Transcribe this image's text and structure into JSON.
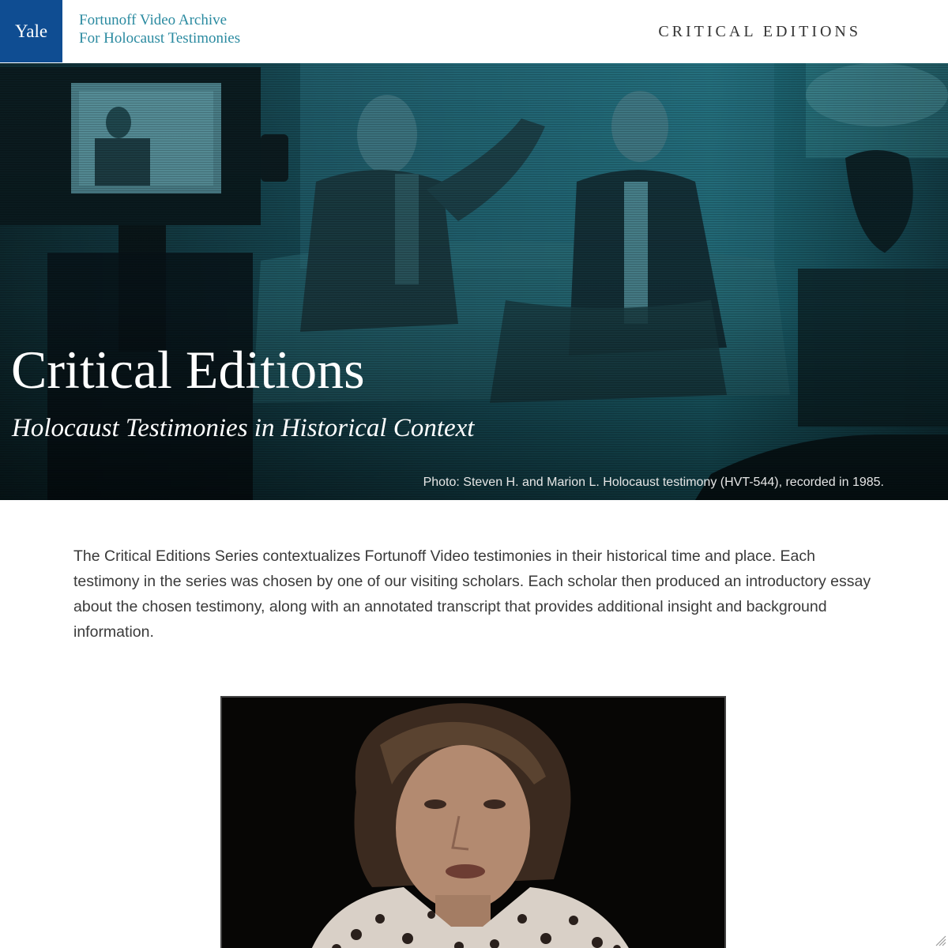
{
  "header": {
    "yale_logo": "Yale",
    "org_line1": "Fortunoff Video Archive",
    "org_line2": "For Holocaust Testimonies",
    "nav_title": "CRITICAL EDITIONS"
  },
  "hero": {
    "title": "Critical Editions",
    "subtitle": "Holocaust Testimonies in Historical Context",
    "photo_caption": "Photo: Steven H. and Marion L. Holocaust testimony (HVT-544), recorded in 1985."
  },
  "intro": {
    "text": "The Critical Editions Series contextualizes Fortunoff Video testimonies in their historical time and place. Each testimony in the series was chosen by one of our visiting scholars. Each scholar then produced an introductory essay about the chosen testimony, along with an annotated transcript that provides additional insight and background information."
  },
  "colors": {
    "yale_blue": "#0f4d92",
    "org_teal": "#2a8aa0",
    "hero_tint": "#1f6f7d",
    "body_text": "#3a3a3a"
  },
  "icons": {
    "resize_grip": "resize-grip-icon"
  }
}
